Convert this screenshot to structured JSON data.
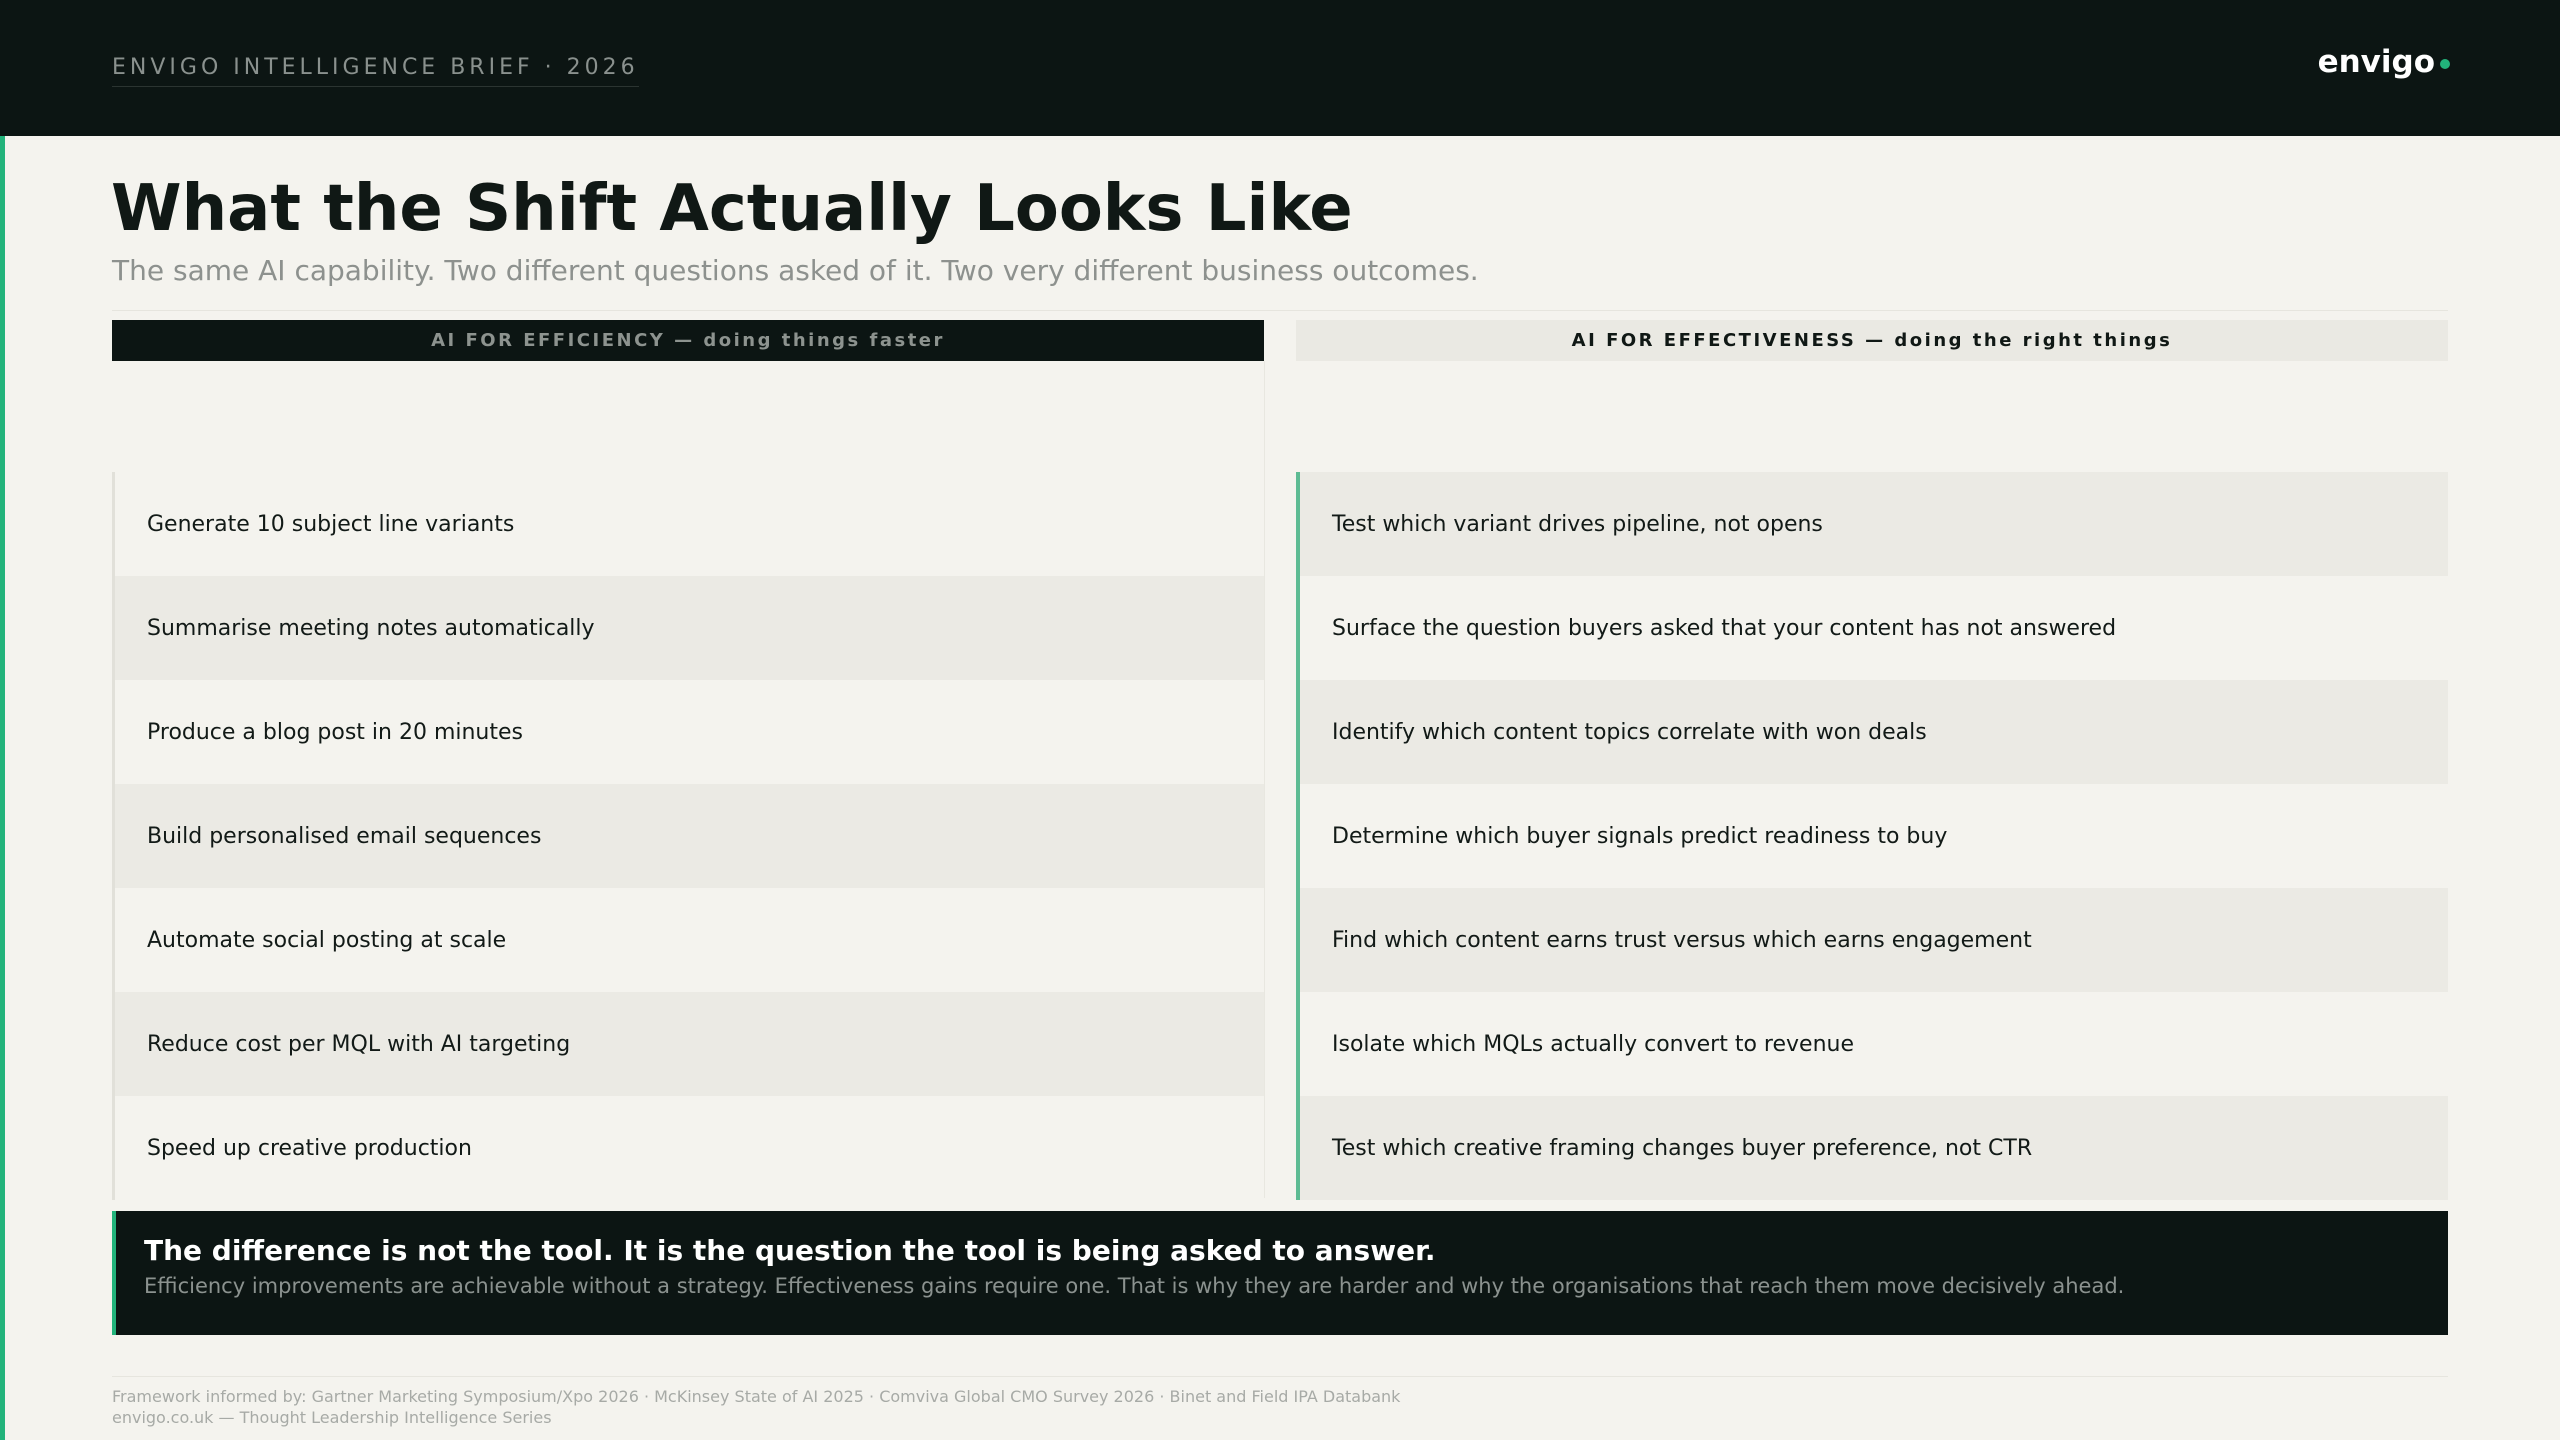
{
  "header": {
    "brief_label": "ENVIGO INTELLIGENCE BRIEF · 2026",
    "logo_text": "envigo",
    "accent_color": "#22b37b",
    "background_color": "#0c1513"
  },
  "page": {
    "title": "What the Shift Actually Looks Like",
    "subtitle": "The same AI capability. Two different questions asked of it. Two very different business outcomes."
  },
  "comparison": {
    "left": {
      "heading": "AI FOR EFFICIENCY — doing things faster",
      "items": [
        "Generate 10 subject line variants",
        "Summarise meeting notes automatically",
        "Produce a blog post in 20 minutes",
        "Build personalised email sequences",
        "Automate social posting at scale",
        "Reduce cost per MQL with AI targeting",
        "Speed up creative production"
      ]
    },
    "right": {
      "heading": "AI FOR EFFECTIVENESS — doing the right things",
      "items": [
        "Test which variant drives pipeline, not opens",
        "Surface the question buyers asked that your content has not answered",
        "Identify which content topics correlate with won deals",
        "Determine which buyer signals predict readiness to buy",
        "Find which content earns trust versus which earns engagement",
        "Isolate which MQLs actually convert to revenue",
        "Test which creative framing changes buyer preference, not CTR"
      ]
    }
  },
  "callout": {
    "headline": "The difference is not the tool. It is the question the tool is being asked to answer.",
    "body": "Efficiency improvements are achievable without a strategy. Effectiveness gains require one. That is why they are harder and why the organisations that reach them move decisively ahead."
  },
  "footer": {
    "sources": "Framework informed by: Gartner Marketing Symposium/Xpo 2026 · McKinsey State of AI 2025 · Comviva Global CMO Survey 2026 · Binet and Field IPA Databank",
    "site": "envigo.co.uk — Thought Leadership Intelligence Series"
  }
}
